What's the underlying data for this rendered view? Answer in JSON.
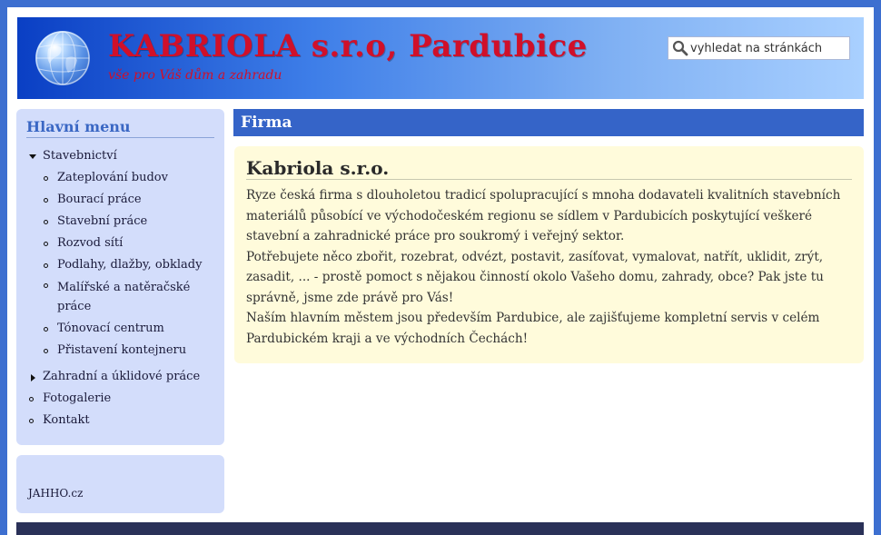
{
  "header": {
    "site_title": "KABRIOLA s.r.o, Pardubice",
    "slogan": "vše pro Váš dům a zahradu",
    "logo_icon": "globe-icon",
    "search": {
      "placeholder": "vyhledat na stránkách",
      "icon": "search-icon"
    }
  },
  "sidebar": {
    "menu_title": "Hlavní menu",
    "items": [
      {
        "label": "Stavebnictví",
        "expanded": true,
        "children": [
          "Zateplování budov",
          "Bourací práce",
          "Stavební práce",
          "Rozvod sítí",
          "Podlahy, dlažby, obklady",
          "Malířské a natěračské práce",
          "Tónovací centrum",
          "Přistavení kontejneru"
        ]
      },
      {
        "label": "Zahradní a úklidové práce",
        "expanded": false
      },
      {
        "label": "Fotogalerie"
      },
      {
        "label": "Kontakt"
      }
    ],
    "footer_link": "JAHHO.cz"
  },
  "main": {
    "section_title": "Firma",
    "article": {
      "heading": "Kabriola s.r.o.",
      "paragraphs": [
        "Ryze česká firma s dlouholetou tradicí spolupracující s mnoha dodavateli kvalitních stavebních materiálů působící ve východočeském regionu se sídlem v Pardubicích poskytující veškeré stavební a zahradnické práce pro soukromý i veřejný sektor.",
        "Potřebujete něco zbořit, rozebrat, odvézt, postavit, zasíťovat, vymalovat, natřít, uklidit, zrýt, zasadit, ... - prostě pomoct s nějakou činností okolo Vašeho domu, zahrady, obce? Pak jste tu správně, jsme zde právě pro Vás!",
        "Naším hlavním městem jsou především Pardubice, ale zajišťujeme kompletní servis v celém Pardubickém kraji a ve východních Čechách!"
      ]
    }
  },
  "colors": {
    "frame": "#3d6fd0",
    "header_gradient_start": "#0a3fc4",
    "header_gradient_end": "#a9d0ff",
    "title_red": "#d0102a",
    "sidebar_bg": "#d3ddfb",
    "section_bar": "#3564c8",
    "article_bg": "#fffbdb",
    "footer": "#2a3158"
  }
}
